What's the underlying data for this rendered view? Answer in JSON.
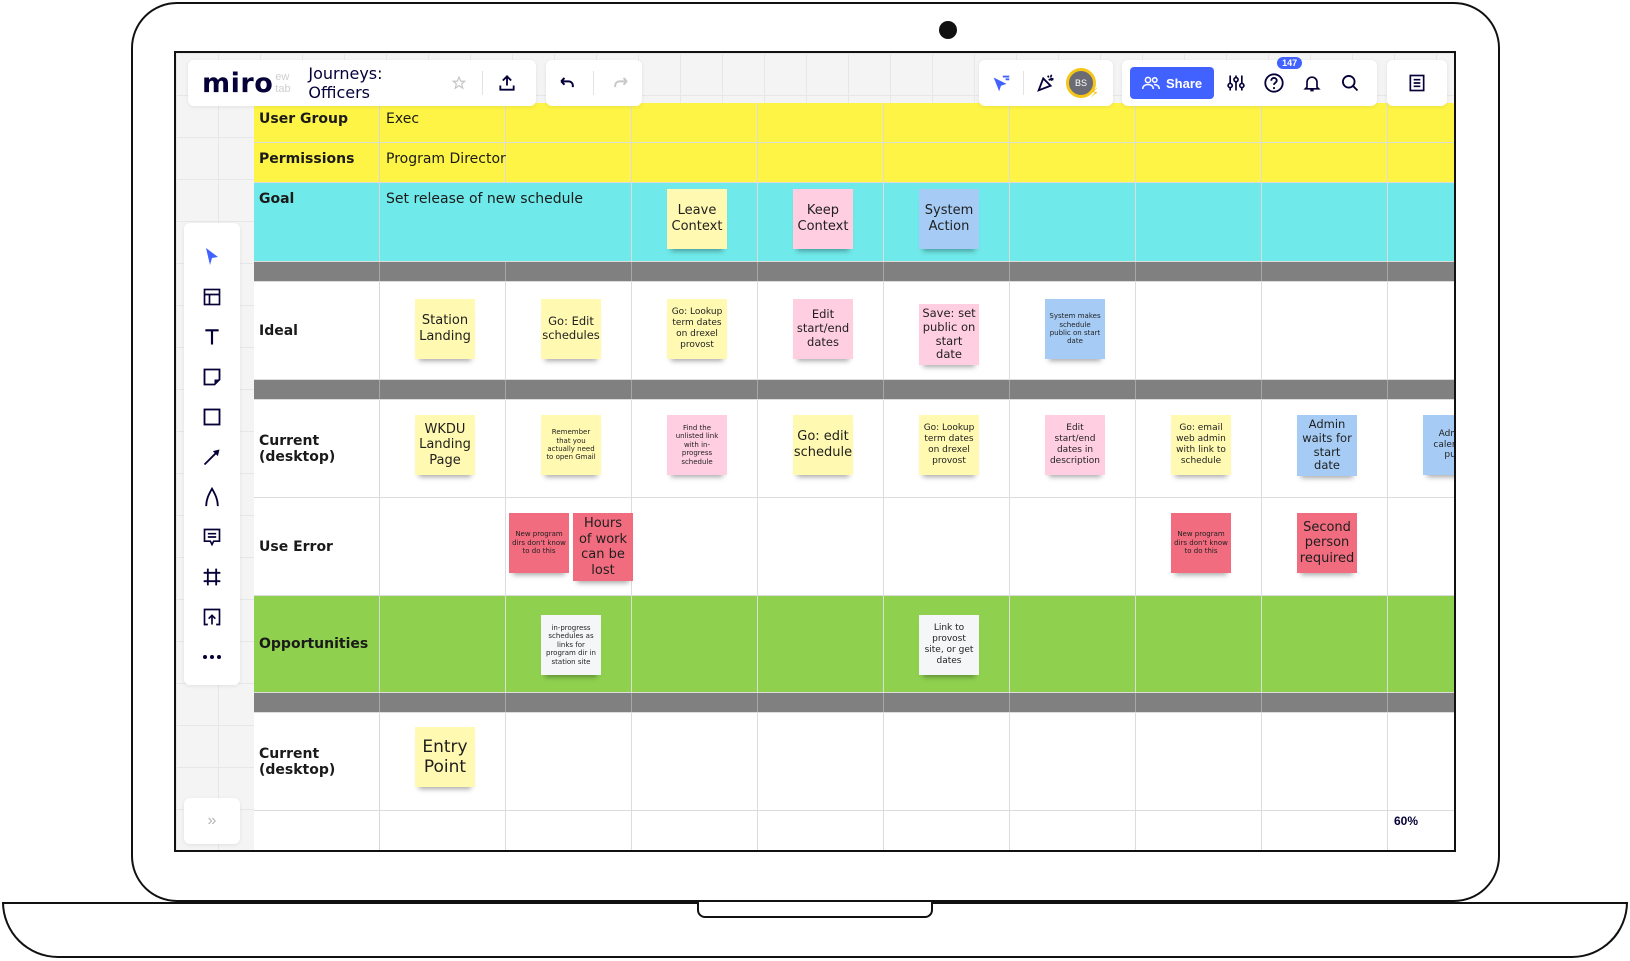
{
  "app": {
    "logo": "miro",
    "ghost_tab_text": "ew tab",
    "board_title": "Journeys: Officers",
    "share_label": "Share",
    "avatar_initials": "BS",
    "help_badge_count": "147",
    "zoom_level": "60%"
  },
  "icons": {
    "star": "star-icon",
    "export": "upload-icon",
    "undo": "undo-icon",
    "redo": "redo-icon",
    "cursor_follow": "cursor-follow-icon",
    "celebrate": "party-popper-icon",
    "settings": "sliders-icon",
    "help": "help-icon",
    "bell": "bell-icon",
    "search": "search-icon",
    "notes": "notes-icon"
  },
  "tools": [
    {
      "name": "select",
      "icon": "pointer-icon"
    },
    {
      "name": "templates",
      "icon": "template-icon"
    },
    {
      "name": "text",
      "icon": "text-icon"
    },
    {
      "name": "sticky-note",
      "icon": "sticky-note-icon"
    },
    {
      "name": "shape",
      "icon": "square-icon"
    },
    {
      "name": "connection-line",
      "icon": "arrow-icon"
    },
    {
      "name": "pen",
      "icon": "pen-icon"
    },
    {
      "name": "comment",
      "icon": "comment-icon"
    },
    {
      "name": "frame",
      "icon": "frame-icon"
    },
    {
      "name": "upload",
      "icon": "upload-icon"
    },
    {
      "name": "more",
      "icon": "more-icon"
    }
  ],
  "board": {
    "rows": {
      "user_group": {
        "label": "User Group",
        "value": "Exec"
      },
      "permissions": {
        "label": "Permissions",
        "value": "Program Director"
      },
      "goal": {
        "label": "Goal",
        "value": "Set release of new schedule"
      },
      "ideal": {
        "label": "Ideal"
      },
      "current": {
        "label": "Current (desktop)"
      },
      "use_error": {
        "label": "Use Error"
      },
      "opportunities": {
        "label": "Opportunities"
      },
      "current2": {
        "label": "Current (desktop)"
      }
    },
    "legend": [
      {
        "text": "Leave Context",
        "color": "yellow"
      },
      {
        "text": "Keep Context",
        "color": "pink"
      },
      {
        "text": "System Action",
        "color": "blue"
      }
    ],
    "ideal": [
      {
        "text": "Station Landing",
        "color": "yellow"
      },
      {
        "text": "Go: Edit schedules",
        "color": "yellow"
      },
      {
        "text": "Go: Lookup term dates on drexel provost",
        "color": "yellow"
      },
      {
        "text": "Edit start/end dates",
        "color": "pink"
      },
      {
        "text": "Save: set public on start date",
        "color": "pink"
      },
      {
        "text": "System makes schedule public on start date",
        "color": "blue"
      }
    ],
    "current": [
      {
        "text": "WKDU Landing Page",
        "color": "yellow"
      },
      {
        "text": "Remember that you actually need to open Gmail",
        "color": "yellow"
      },
      {
        "text": "Find the unlisted link with in-progress schedule",
        "color": "pink"
      },
      {
        "text": "Go: edit schedule",
        "color": "yellow"
      },
      {
        "text": "Go: Lookup term dates on drexel provost",
        "color": "yellow"
      },
      {
        "text": "Edit start/end dates in description",
        "color": "pink"
      },
      {
        "text": "Go: email web admin with link to schedule",
        "color": "yellow"
      },
      {
        "text": "Admin waits for start date",
        "color": "blue"
      },
      {
        "text": "Admin calendar pub",
        "color": "blue"
      }
    ],
    "use_error": [
      {
        "text": "New program dirs don't know to do this",
        "color": "red"
      },
      {
        "text": "Hours of work can be lost",
        "color": "red"
      },
      {
        "text": "New program dirs don't know to do this",
        "color": "red"
      },
      {
        "text": "Second person required",
        "color": "red"
      }
    ],
    "opportunities": [
      {
        "text": "in-progress schedules as links for program dir in station site",
        "color": "white"
      },
      {
        "text": "Link to provost site, or get dates",
        "color": "white"
      }
    ],
    "current2": [
      {
        "text": "Entry Point",
        "color": "yellow"
      }
    ]
  }
}
